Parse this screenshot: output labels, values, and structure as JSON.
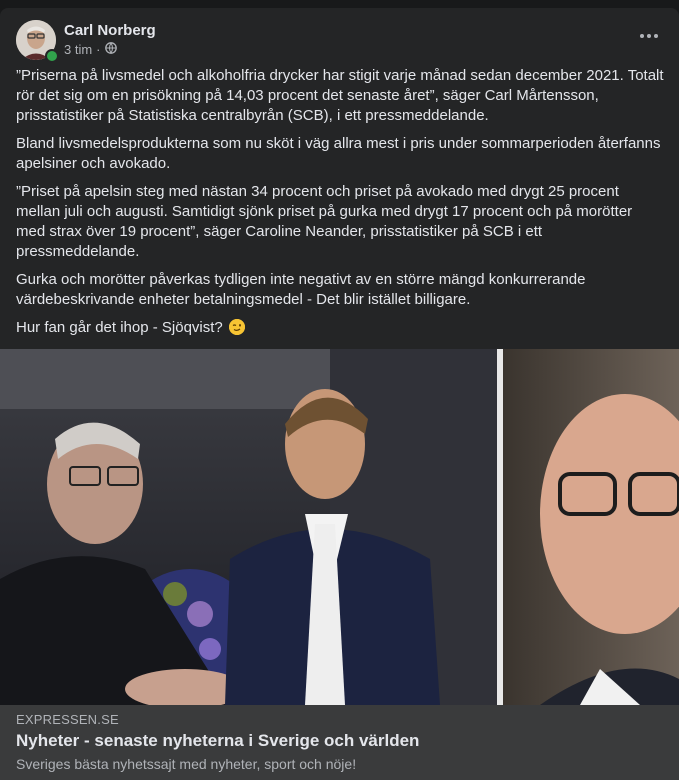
{
  "post": {
    "author": "Carl Norberg",
    "time": "3 tim",
    "separator": "·",
    "audience_icon": "globe-icon",
    "more_icon": "more-horizontal-icon",
    "paragraphs": [
      "”Priserna på livsmedel och alkoholfria drycker har stigit varje månad sedan december 2021. Totalt rör det sig om en prisökning på 14,03 procent det senaste året”, säger Carl Mårtensson, prisstatistiker på Statistiska centralbyrån (SCB), i ett pressmeddelande.",
      "Bland livsmedelsprodukterna som nu sköt i väg allra mest i pris under sommarperioden återfanns apelsiner och avokado.",
      "”Priset på apelsin steg med nästan 34 procent och priset på avokado med drygt 25 procent mellan juli och augusti. Samtidigt sjönk priset på gurka med drygt 17 procent och på morötter med strax över 19 procent”, säger Caroline Neander, prisstatistiker på SCB i ett pressmeddelande.",
      "Gurka och morötter påverkas tydligen inte negativt av en större mängd konkurrerande värdebeskrivande enheter betalningsmedel - Det blir istället billigare."
    ],
    "last_line": "Hur fan går det ihop - Sjöqvist?",
    "emoji_icon": "winking-face-icon"
  },
  "link": {
    "domain": "EXPRESSEN.SE",
    "title": "Nyheter - senaste nyheterna i Sverige och världen",
    "description": "Sveriges bästa nyhetssajt med nyheter, sport och nöje!"
  },
  "colors": {
    "card_bg": "#242526",
    "page_bg": "#18191a",
    "link_bg": "#3a3b3c",
    "text_primary": "#e4e6eb",
    "text_secondary": "#b0b3b8",
    "online": "#31a24c"
  }
}
